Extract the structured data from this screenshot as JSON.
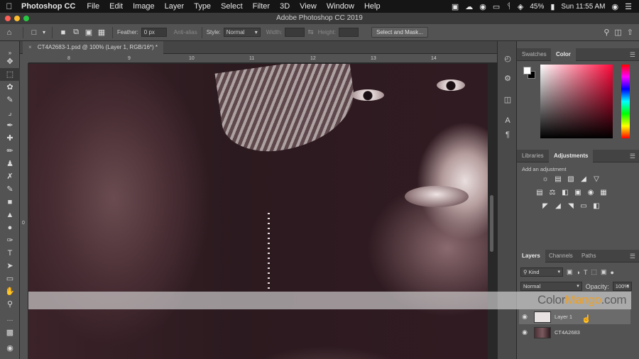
{
  "menubar": {
    "apple": "",
    "app_name": "Photoshop CC",
    "items": [
      "File",
      "Edit",
      "Image",
      "Layer",
      "Type",
      "Select",
      "Filter",
      "3D",
      "View",
      "Window",
      "Help"
    ],
    "battery": "45%",
    "clock": "Sun 11:55 AM"
  },
  "window": {
    "title": "Adobe Photoshop CC 2019",
    "lights": [
      "#ff5f57",
      "#febc2e",
      "#28c840"
    ]
  },
  "options": {
    "feather_label": "Feather:",
    "feather_value": "0 px",
    "antialias_label": "Anti-alias",
    "style_label": "Style:",
    "style_value": "Normal",
    "width_label": "Width:",
    "height_label": "Height:",
    "mask_button": "Select and Mask..."
  },
  "document": {
    "tab_title": "CT4A2683-1.psd @ 100% (Layer 1, RGB/16*) *",
    "close": "×",
    "ruler_h": [
      "8",
      "9",
      "10",
      "11",
      "12",
      "13",
      "14"
    ],
    "ruler_v": [
      "0"
    ]
  },
  "panels": {
    "color_tabs": [
      "Swatches",
      "Color"
    ],
    "adjust_tabs": [
      "Libraries",
      "Adjustments"
    ],
    "add_adjustment": "Add an adjustment",
    "layers_tabs": [
      "Layers",
      "Channels",
      "Paths"
    ],
    "kind": "Kind",
    "blend": "Normal",
    "opacity_label": "Opacity:",
    "opacity_value": "100%",
    "layers": [
      {
        "name": "Layer 1"
      },
      {
        "name": "CT4A2683"
      }
    ]
  },
  "watermark": {
    "a": "Color",
    "b": "Mango",
    "c": ".com"
  },
  "colors": {
    "menubar": "#151515",
    "panel": "#535353",
    "canvas_bg": "#282828",
    "accent": "#f0a020"
  }
}
